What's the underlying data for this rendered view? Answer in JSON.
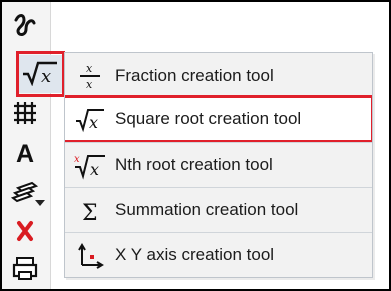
{
  "window": {
    "toolbar": {
      "items": [
        {
          "name": "curve-tool",
          "icon": "curve-icon"
        },
        {
          "name": "square-root-tool",
          "icon": "square-root-icon"
        },
        {
          "name": "grid-tool",
          "icon": "grid-icon"
        },
        {
          "name": "text-tool",
          "icon": "text-icon"
        },
        {
          "name": "layers-tool",
          "icon": "layers-icon"
        },
        {
          "name": "delete-tool",
          "icon": "red-x-icon"
        },
        {
          "name": "print-tool",
          "icon": "printer-icon"
        }
      ],
      "text_tool_label": "A"
    },
    "menu": {
      "items": [
        {
          "label": "Fraction creation tool",
          "icon": "fraction-icon"
        },
        {
          "label": "Square root creation tool",
          "icon": "square-root-icon",
          "selected": true
        },
        {
          "label": "Nth root creation tool",
          "icon": "nth-root-icon"
        },
        {
          "label": "Summation creation tool",
          "icon": "summation-icon"
        },
        {
          "label": "X Y axis creation tool",
          "icon": "xy-axis-icon"
        }
      ]
    }
  }
}
